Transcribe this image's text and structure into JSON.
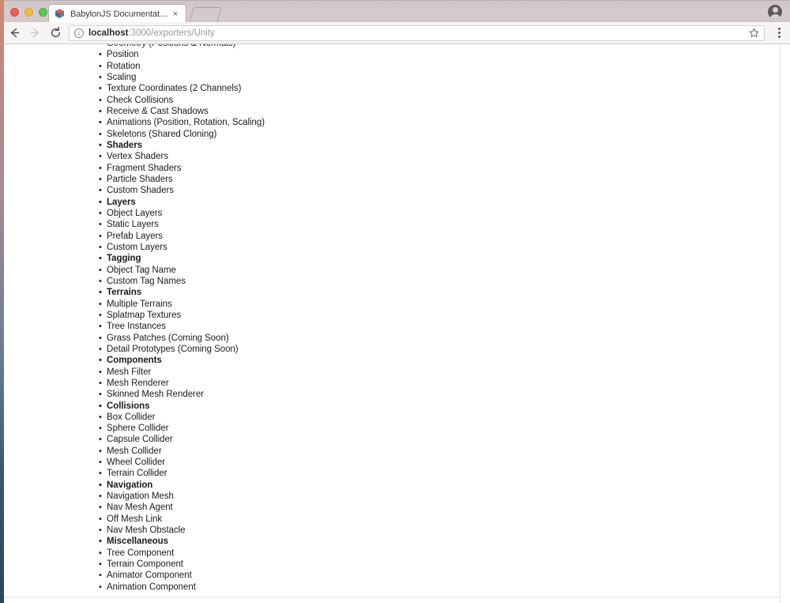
{
  "window": {
    "traffic_lights": [
      "close",
      "minimize",
      "zoom"
    ]
  },
  "tab": {
    "title": "BabylonJS Documentation",
    "favicon": "babylonjs-cube-icon",
    "close_label": "×",
    "new_tab_label": "+"
  },
  "toolbar": {
    "back_icon": "arrow-left-icon",
    "forward_icon": "arrow-right-icon",
    "reload_icon": "reload-icon",
    "info_icon": "ⓘ",
    "url_host": "localhost",
    "url_path": ":3000/exporters/Unity",
    "url_full": "localhost:3000/exporters/Unity",
    "star_icon": "star-icon",
    "menu_icon": "three-dot-menu-icon",
    "profile_icon": "profile-avatar-icon"
  },
  "page": {
    "list_items": [
      {
        "label": "Geometry (Positions & Normals)",
        "header": false
      },
      {
        "label": "Position",
        "header": false
      },
      {
        "label": "Rotation",
        "header": false
      },
      {
        "label": "Scaling",
        "header": false
      },
      {
        "label": "Texture Coordinates (2 Channels)",
        "header": false
      },
      {
        "label": "Check Collisions",
        "header": false
      },
      {
        "label": "Receive & Cast Shadows",
        "header": false
      },
      {
        "label": "Animations (Position, Rotation, Scaling)",
        "header": false
      },
      {
        "label": "Skeletons (Shared Cloning)",
        "header": false
      },
      {
        "label": "Shaders",
        "header": true
      },
      {
        "label": "Vertex Shaders",
        "header": false
      },
      {
        "label": "Fragment Shaders",
        "header": false
      },
      {
        "label": "Particle Shaders",
        "header": false
      },
      {
        "label": "Custom Shaders",
        "header": false
      },
      {
        "label": "Layers",
        "header": true
      },
      {
        "label": "Object Layers",
        "header": false
      },
      {
        "label": "Static Layers",
        "header": false
      },
      {
        "label": "Prefab Layers",
        "header": false
      },
      {
        "label": "Custom Layers",
        "header": false
      },
      {
        "label": "Tagging",
        "header": true
      },
      {
        "label": "Object Tag Name",
        "header": false
      },
      {
        "label": "Custom Tag Names",
        "header": false
      },
      {
        "label": "Terrains",
        "header": true
      },
      {
        "label": "Multiple Terrains",
        "header": false
      },
      {
        "label": "Splatmap Textures",
        "header": false
      },
      {
        "label": "Tree Instances",
        "header": false
      },
      {
        "label": "Grass Patches (Coming Soon)",
        "header": false
      },
      {
        "label": "Detail Prototypes (Coming Soon)",
        "header": false
      },
      {
        "label": "Components",
        "header": true
      },
      {
        "label": "Mesh Filter",
        "header": false
      },
      {
        "label": "Mesh Renderer",
        "header": false
      },
      {
        "label": "Skinned Mesh Renderer",
        "header": false
      },
      {
        "label": "Collisions",
        "header": true
      },
      {
        "label": "Box Collider",
        "header": false
      },
      {
        "label": "Sphere Collider",
        "header": false
      },
      {
        "label": "Capsule Collider",
        "header": false
      },
      {
        "label": "Mesh Collider",
        "header": false
      },
      {
        "label": "Wheel Collider",
        "header": false
      },
      {
        "label": "Terrain Collider",
        "header": false
      },
      {
        "label": "Navigation",
        "header": true
      },
      {
        "label": "Navigation Mesh",
        "header": false
      },
      {
        "label": "Nav Mesh Agent",
        "header": false
      },
      {
        "label": "Off Mesh Link",
        "header": false
      },
      {
        "label": "Nav Mesh Obstacle",
        "header": false
      },
      {
        "label": "Miscellaneous",
        "header": true
      },
      {
        "label": "Tree Component",
        "header": false
      },
      {
        "label": "Terrain Component",
        "header": false
      },
      {
        "label": "Animator Component",
        "header": false
      },
      {
        "label": "Animation Component",
        "header": false
      }
    ]
  }
}
